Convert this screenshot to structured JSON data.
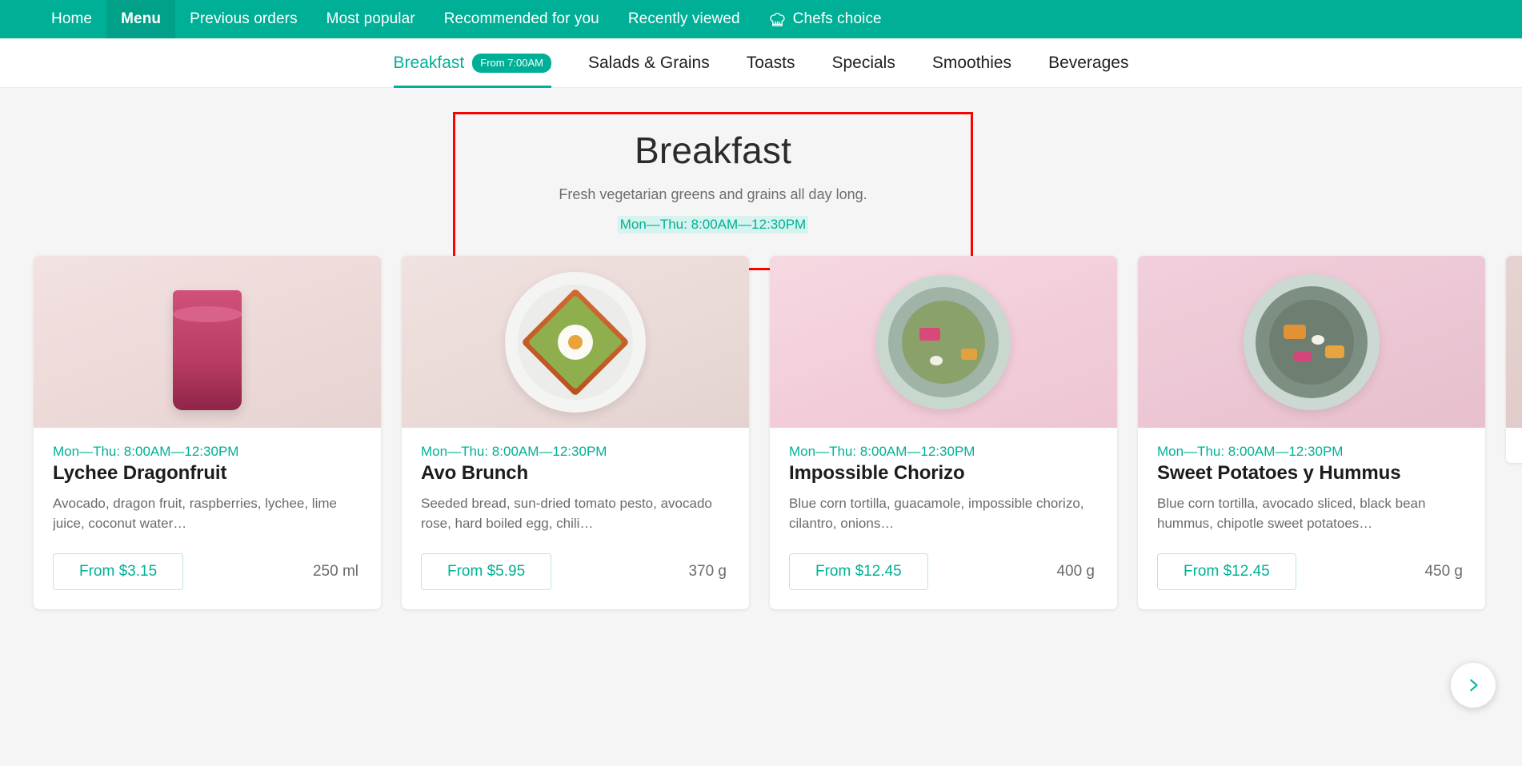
{
  "colors": {
    "brand_teal": "#00b096",
    "brand_teal_dark": "#00a089",
    "annotation_red": "#ff0000",
    "page_bg": "#f5f5f5",
    "highlight_bg": "#d6f3ee"
  },
  "topnav": {
    "items": [
      {
        "label": "Home",
        "active": false,
        "icon": null
      },
      {
        "label": "Menu",
        "active": true,
        "icon": null
      },
      {
        "label": "Previous orders",
        "active": false,
        "icon": null
      },
      {
        "label": "Most popular",
        "active": false,
        "icon": null
      },
      {
        "label": "Recommended for you",
        "active": false,
        "icon": null
      },
      {
        "label": "Recently viewed",
        "active": false,
        "icon": null
      },
      {
        "label": "Chefs choice",
        "active": false,
        "icon": "chef-hat-icon"
      }
    ]
  },
  "tabs": [
    {
      "label": "Breakfast",
      "badge": "From 7:00AM",
      "active": true
    },
    {
      "label": "Salads & Grains",
      "badge": null,
      "active": false
    },
    {
      "label": "Toasts",
      "badge": null,
      "active": false
    },
    {
      "label": "Specials",
      "badge": null,
      "active": false
    },
    {
      "label": "Smoothies",
      "badge": null,
      "active": false
    },
    {
      "label": "Beverages",
      "badge": null,
      "active": false
    }
  ],
  "hero": {
    "title": "Breakfast",
    "subtitle": "Fresh vegetarian greens and grains all day long.",
    "hours": "Mon—Thu: 8:00AM—12:30PM"
  },
  "carousel": {
    "next_label": "›",
    "cards": [
      {
        "hours": "Mon—Thu: 8:00AM—12:30PM",
        "title": "Lychee Dragonfruit",
        "description": "Avocado, dragon fruit, raspberries, lychee, lime juice, coconut water…",
        "price": "From $3.15",
        "weight": "250 ml"
      },
      {
        "hours": "Mon—Thu: 8:00AM—12:30PM",
        "title": "Avo Brunch",
        "description": "Seeded bread, sun-dried tomato pesto, avocado rose, hard boiled egg, chili…",
        "price": "From $5.95",
        "weight": "370 g"
      },
      {
        "hours": "Mon—Thu: 8:00AM—12:30PM",
        "title": "Impossible Chorizo",
        "description": "Blue corn tortilla, guacamole, impossible chorizo, cilantro, onions…",
        "price": "From $12.45",
        "weight": "400 g"
      },
      {
        "hours": "Mon—Thu: 8:00AM—12:30PM",
        "title": "Sweet Potatoes y Hummus",
        "description": "Blue corn tortilla, avocado sliced, black bean hummus, chipotle sweet potatoes…",
        "price": "From $12.45",
        "weight": "450 g"
      }
    ]
  }
}
